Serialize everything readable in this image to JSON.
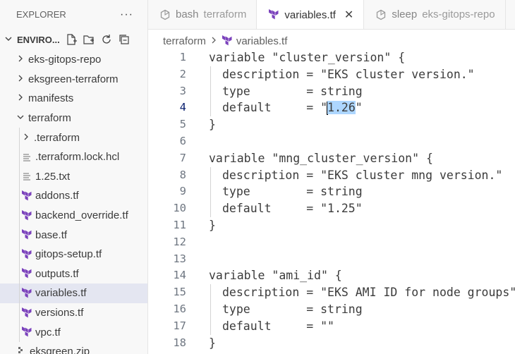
{
  "explorer": {
    "header_title": "EXPLORER",
    "more_label": "···",
    "section_title": "ENVIRO...",
    "tree": [
      {
        "label": "eks-gitops-repo",
        "kind": "folder",
        "expanded": false,
        "depth": 0
      },
      {
        "label": "eksgreen-terraform",
        "kind": "folder",
        "expanded": false,
        "depth": 0
      },
      {
        "label": "manifests",
        "kind": "folder",
        "expanded": false,
        "depth": 0
      },
      {
        "label": "terraform",
        "kind": "folder",
        "expanded": true,
        "depth": 0
      },
      {
        "label": ".terraform",
        "kind": "folder",
        "expanded": false,
        "depth": 1
      },
      {
        "label": ".terraform.lock.hcl",
        "kind": "file-lines",
        "depth": 1
      },
      {
        "label": "1.25.txt",
        "kind": "file-lines",
        "depth": 1
      },
      {
        "label": "addons.tf",
        "kind": "terraform",
        "depth": 1
      },
      {
        "label": "backend_override.tf",
        "kind": "terraform",
        "depth": 1
      },
      {
        "label": "base.tf",
        "kind": "terraform",
        "depth": 1
      },
      {
        "label": "gitops-setup.tf",
        "kind": "terraform",
        "depth": 1
      },
      {
        "label": "outputs.tf",
        "kind": "terraform",
        "depth": 1
      },
      {
        "label": "variables.tf",
        "kind": "terraform",
        "depth": 1,
        "selected": true
      },
      {
        "label": "versions.tf",
        "kind": "terraform",
        "depth": 1
      },
      {
        "label": "vpc.tf",
        "kind": "terraform",
        "depth": 1
      },
      {
        "label": "eksgreen.zip",
        "kind": "zip",
        "depth": 0
      }
    ]
  },
  "tabs": [
    {
      "label": "bash",
      "desc": "terraform",
      "icon": "sleep-bash-icon",
      "active": false
    },
    {
      "label": "variables.tf",
      "icon": "terraform-icon",
      "active": true,
      "close": "✕"
    },
    {
      "label": "sleep",
      "desc": "eks-gitops-repo",
      "icon": "sleep-bash-icon",
      "active": false
    }
  ],
  "breadcrumb": {
    "folder": "terraform",
    "file": "variables.tf"
  },
  "editor": {
    "current_line": 4,
    "lines": [
      {
        "n": "1",
        "text": "variable \"cluster_version\" {",
        "indent": false
      },
      {
        "n": "2",
        "text": "description = \"EKS cluster version.\"",
        "indent": true
      },
      {
        "n": "3",
        "text": "type        = string",
        "indent": true
      },
      {
        "n": "4",
        "pre": "default     = \"",
        "sel": "1.26",
        "post": "\"",
        "indent": true
      },
      {
        "n": "5",
        "text": "}",
        "indent": false
      },
      {
        "n": "6",
        "text": "",
        "indent": false
      },
      {
        "n": "7",
        "text": "variable \"mng_cluster_version\" {",
        "indent": false
      },
      {
        "n": "8",
        "text": "description = \"EKS cluster mng version.\"",
        "indent": true
      },
      {
        "n": "9",
        "text": "type        = string",
        "indent": true
      },
      {
        "n": "10",
        "text": "default     = \"1.25\"",
        "indent": true
      },
      {
        "n": "11",
        "text": "}",
        "indent": false
      },
      {
        "n": "12",
        "text": "",
        "indent": false
      },
      {
        "n": "13",
        "text": "",
        "indent": false
      },
      {
        "n": "14",
        "text": "variable \"ami_id\" {",
        "indent": false
      },
      {
        "n": "15",
        "text": "description = \"EKS AMI ID for node groups\"",
        "indent": true
      },
      {
        "n": "16",
        "text": "type        = string",
        "indent": true
      },
      {
        "n": "17",
        "text": "default     = \"\"",
        "indent": true
      },
      {
        "n": "18",
        "text": "}",
        "indent": false
      }
    ]
  },
  "colors": {
    "terraform": "#7b42bc",
    "selection": "#add6ff",
    "selected_row": "#e4e6f1"
  }
}
